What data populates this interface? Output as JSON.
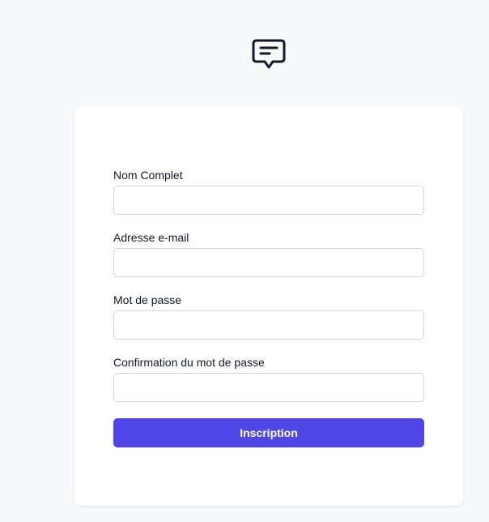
{
  "logo": {
    "icon": "chat-bubble-icon",
    "color": "#111827"
  },
  "form": {
    "fields": [
      {
        "label": "Nom Complet",
        "value": "",
        "placeholder": ""
      },
      {
        "label": "Adresse e-mail",
        "value": "",
        "placeholder": ""
      },
      {
        "label": "Mot de passe",
        "value": "",
        "placeholder": ""
      },
      {
        "label": "Confirmation du mot de passe",
        "value": "",
        "placeholder": ""
      }
    ],
    "submit_label": "Inscription"
  },
  "colors": {
    "background": "#f8f9fb",
    "card": "#ffffff",
    "accent": "#4f46e5",
    "input_border": "#d1d5db"
  }
}
